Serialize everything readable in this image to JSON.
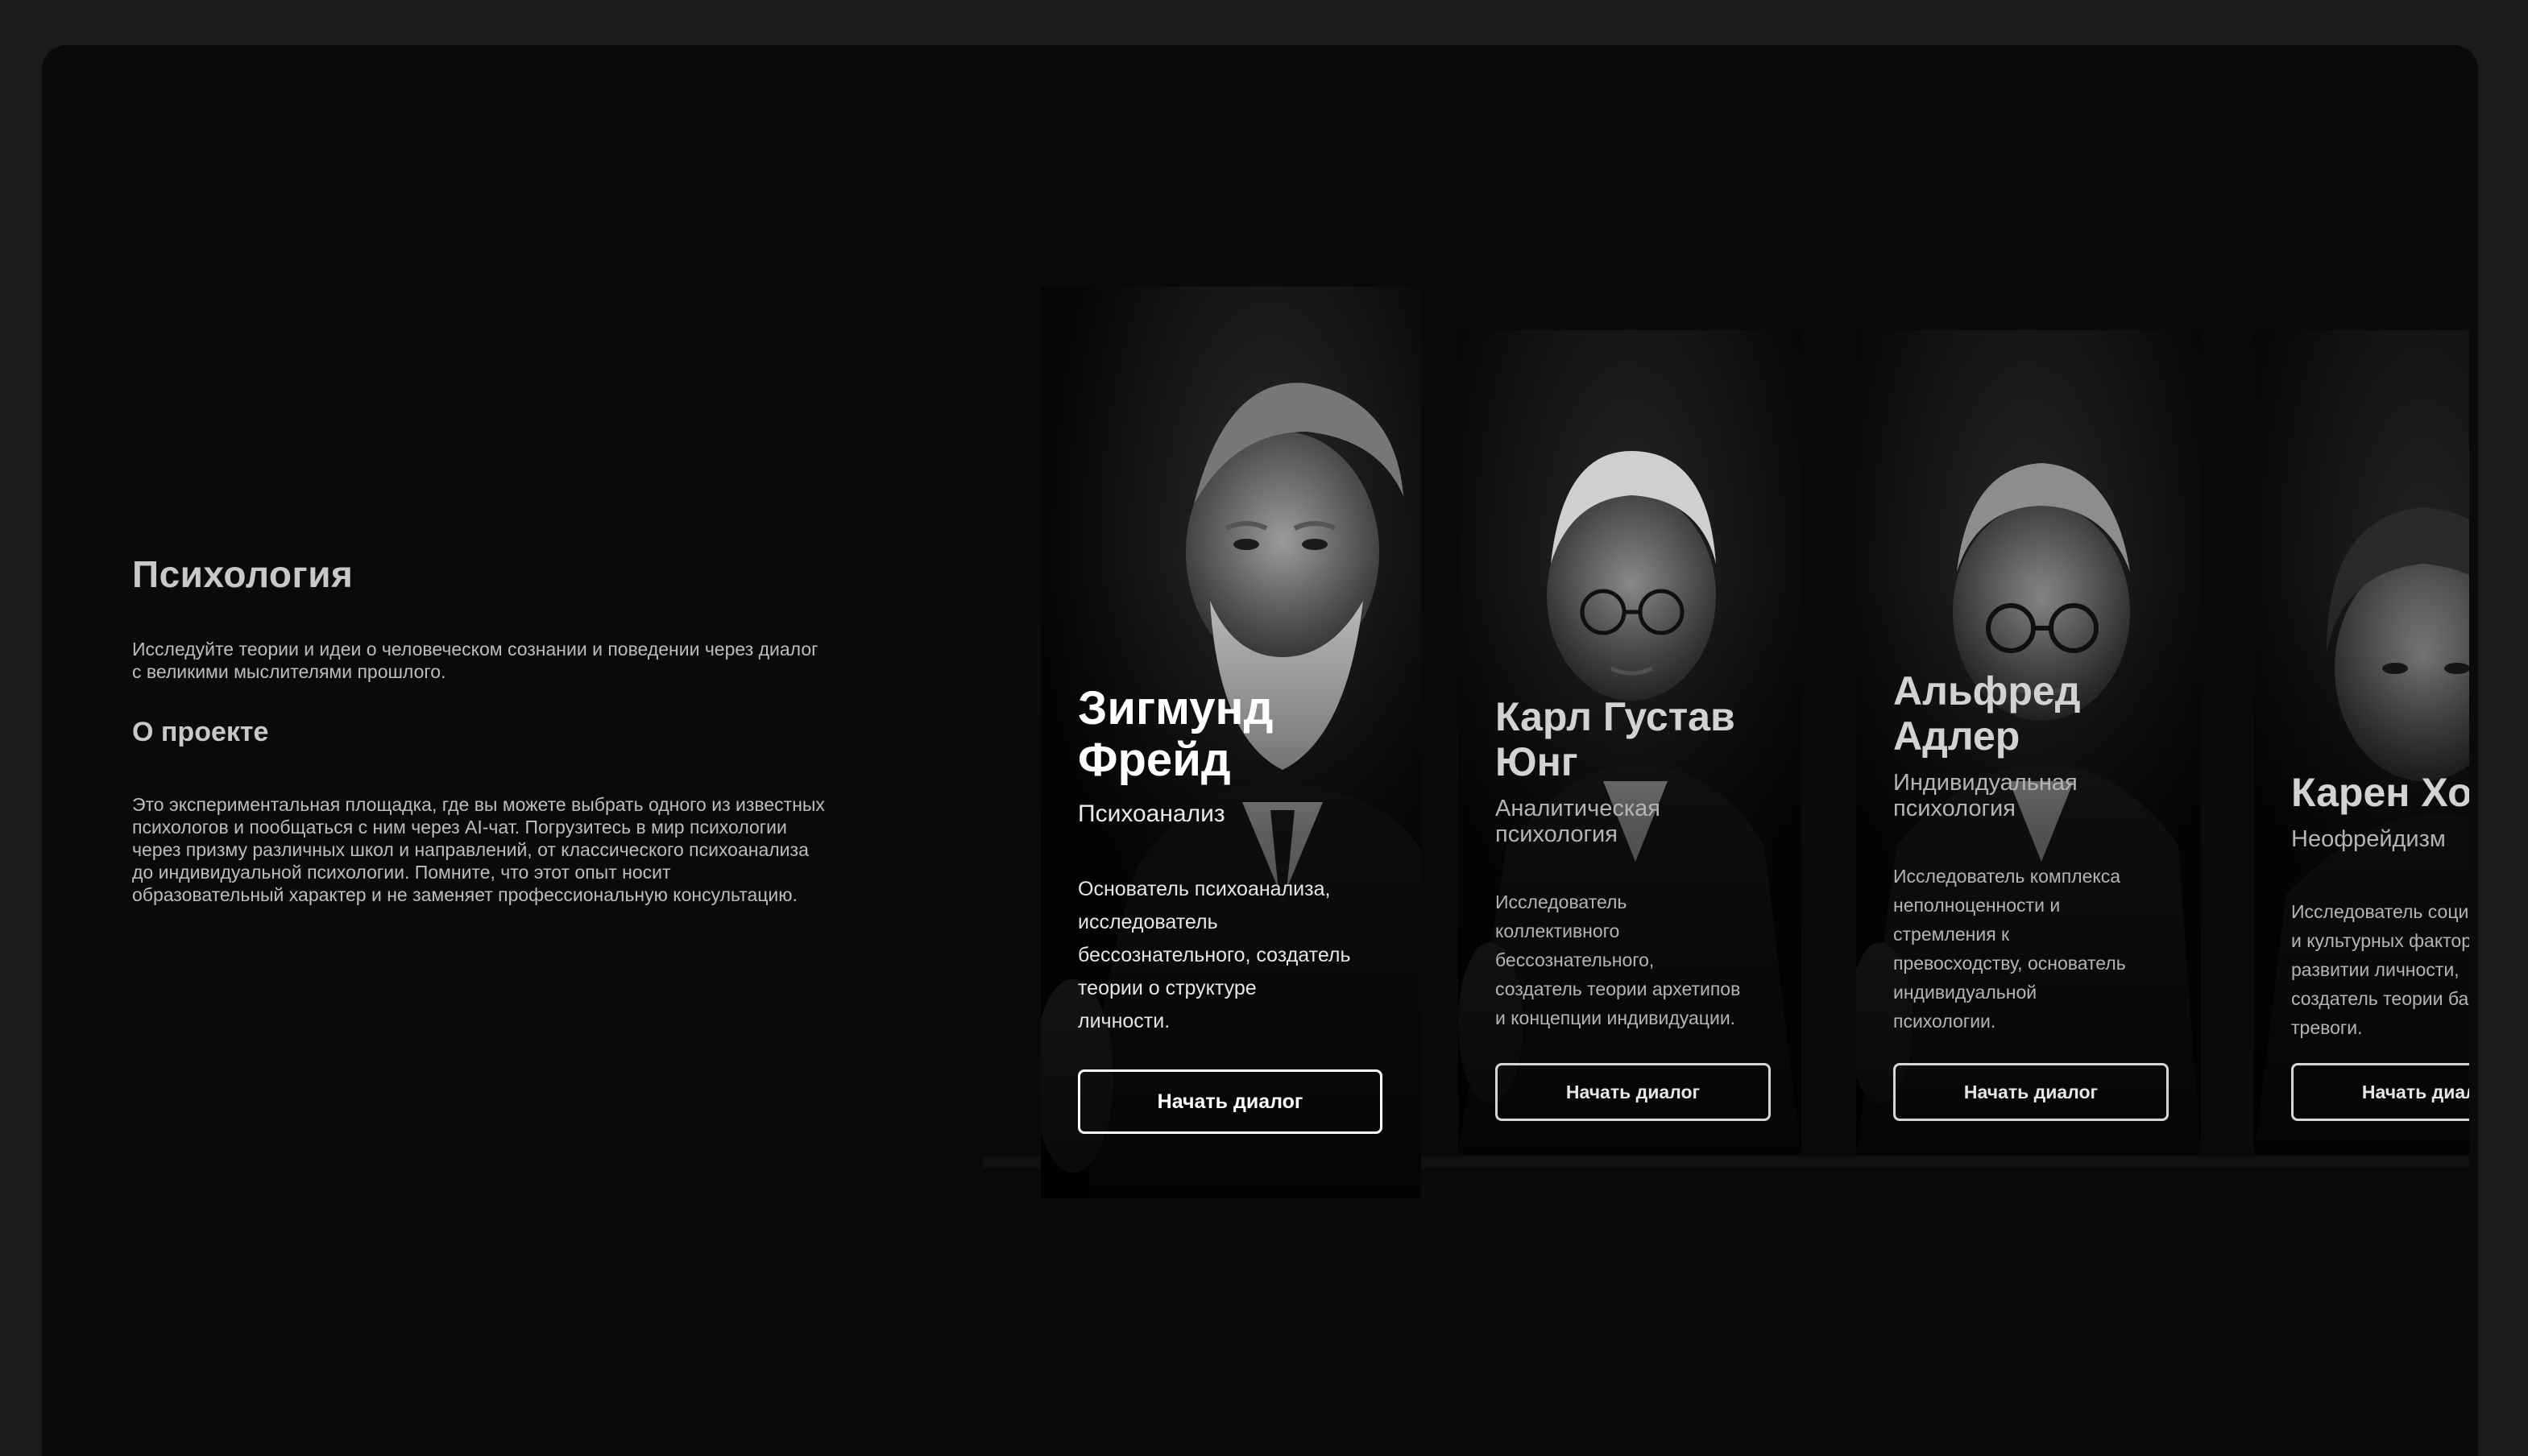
{
  "intro": {
    "title": "Психология",
    "lead": "Исследуйте теории и идеи о человеческом сознании и поведении через диалог с великими мыслителями прошлого.",
    "about_heading": "О проекте",
    "about_text": "Это экспериментальная площадка, где вы можете выбрать одного из известных психологов и пообщаться с ним через AI-чат. Погрузитесь в мир психологии через призму различных школ и направлений, от классического психоанализа до индивидуальной психологии. Помните, что этот опыт носит образовательный характер и не заменяет профессиональную консультацию."
  },
  "cards": [
    {
      "name": "Зигмунд Фрейд",
      "school": "Психоанализ",
      "description": "Основатель психоанализа, исследователь бессознательного, создатель теории о структуре личности.",
      "button": "Начать диалог"
    },
    {
      "name": "Карл Густав Юнг",
      "school": "Аналитическая психология",
      "description": "Исследователь коллективного бессознательного, создатель теории архетипов и концепции индивидуации.",
      "button": "Начать диалог"
    },
    {
      "name": "Альфред Адлер",
      "school": "Индивидуальная психология",
      "description": "Исследователь комплекса неполноценности и стремления к превосходству, основатель индивидуальной психологии.",
      "button": "Начать диалог"
    },
    {
      "name": "Карен Хорни",
      "school": "Неофрейдизм",
      "description": "Исследователь социальных и культурных факторов в развитии личности, создатель теории базальной тревоги.",
      "button": "Начать диалог"
    }
  ],
  "colors": {
    "page_background": "#1b1b1d",
    "frame_background": "#0a0a0b",
    "text_primary": "#ffffff",
    "text_muted": "#bdbdbd"
  }
}
